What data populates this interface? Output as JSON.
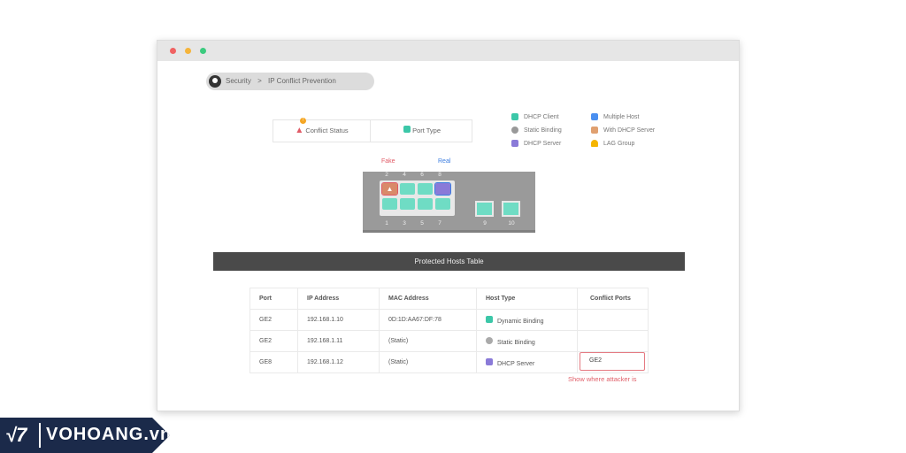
{
  "breadcrumb": {
    "section": "Security",
    "separator": ">",
    "page": "IP Conflict Prevention"
  },
  "legend_box": {
    "conflict_status": "Conflict Status",
    "conflict_badge": "!",
    "port_type": "Port Type"
  },
  "legend": [
    {
      "label": "DHCP Client",
      "icon": "dhcp-client-icon",
      "color": "#3cc7a8"
    },
    {
      "label": "Static Binding",
      "icon": "static-binding-icon",
      "color": "#999999"
    },
    {
      "label": "DHCP Server",
      "icon": "dhcp-server-icon",
      "color": "#8a7ad8"
    },
    {
      "label": "Multiple Host",
      "icon": "multiple-host-icon",
      "color": "#4a8ff0"
    },
    {
      "label": "With DHCP Server",
      "icon": "with-dhcp-server-icon",
      "color": "#e0a070"
    },
    {
      "label": "LAG Group",
      "icon": "lag-group-icon",
      "color": "#f5b500"
    }
  ],
  "switch": {
    "fake_label": "Fake",
    "real_label": "Real",
    "top_ports": [
      "2",
      "4",
      "6",
      "8"
    ],
    "bottom_ports": [
      "1",
      "3",
      "5",
      "7"
    ],
    "sfp_ports": [
      "9",
      "10"
    ],
    "fake_color": "#e05a66",
    "real_color": "#3b7de0"
  },
  "table": {
    "title": "Protected Hosts Table",
    "headers": [
      "Port",
      "IP Address",
      "MAC Address",
      "Host Type",
      "Conflict Ports"
    ],
    "rows": [
      {
        "port": "GE2",
        "ip": "192.168.1.10",
        "mac": "0D:1D:AA67:DF:78",
        "host_type": "Dynamic Binding",
        "conflict": ""
      },
      {
        "port": "GE2",
        "ip": "192.168.1.11",
        "mac": "(Static)",
        "host_type": "Static Binding",
        "conflict": ""
      },
      {
        "port": "GE8",
        "ip": "192.168.1.12",
        "mac": "(Static)",
        "host_type": "DHCP Server",
        "conflict": "GE2"
      }
    ]
  },
  "annotation": "Show where attacker is",
  "logo": {
    "text": "VOHOANG.vn"
  }
}
